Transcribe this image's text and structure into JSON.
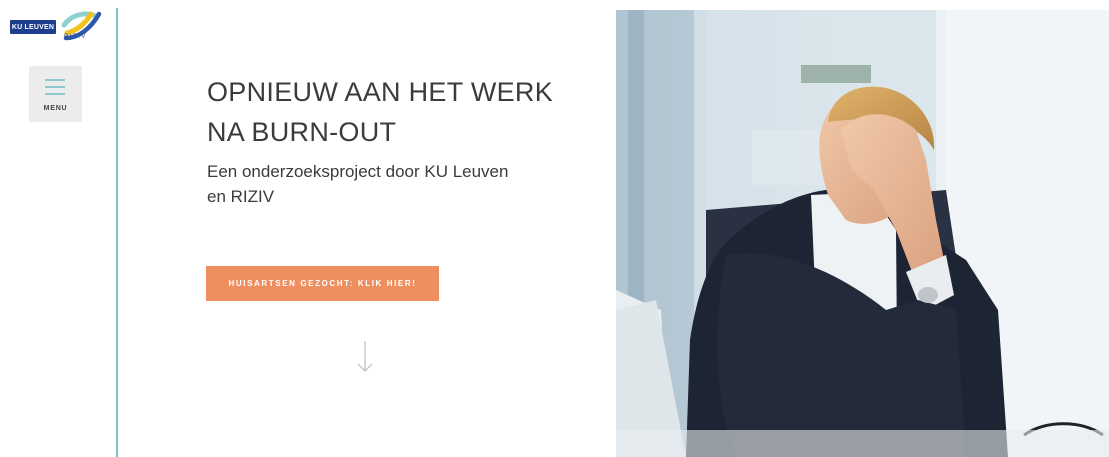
{
  "branding": {
    "university_logo_text": "KU LEUVEN",
    "agency_logo_text": "RIZIV"
  },
  "menu": {
    "label": "MENU"
  },
  "hero": {
    "title": "OPNIEUW AAN HET WERK NA BURN-OUT",
    "subtitle": "Een onderzoeksproject door KU Leuven en RIZIV",
    "cta_label": "HUISARTSEN GEZOCHT: KLIK HIER!"
  },
  "icons": {
    "menu": "hamburger-menu-icon",
    "scroll": "arrow-down-icon",
    "logo": "riziv-swoosh-icon"
  },
  "colors": {
    "accent_teal": "#7cc4cc",
    "cta_orange": "#ef8f60",
    "kul_blue": "#1d3d8f",
    "riziv_yellow": "#f2c31b",
    "menu_bg": "#ececec"
  }
}
